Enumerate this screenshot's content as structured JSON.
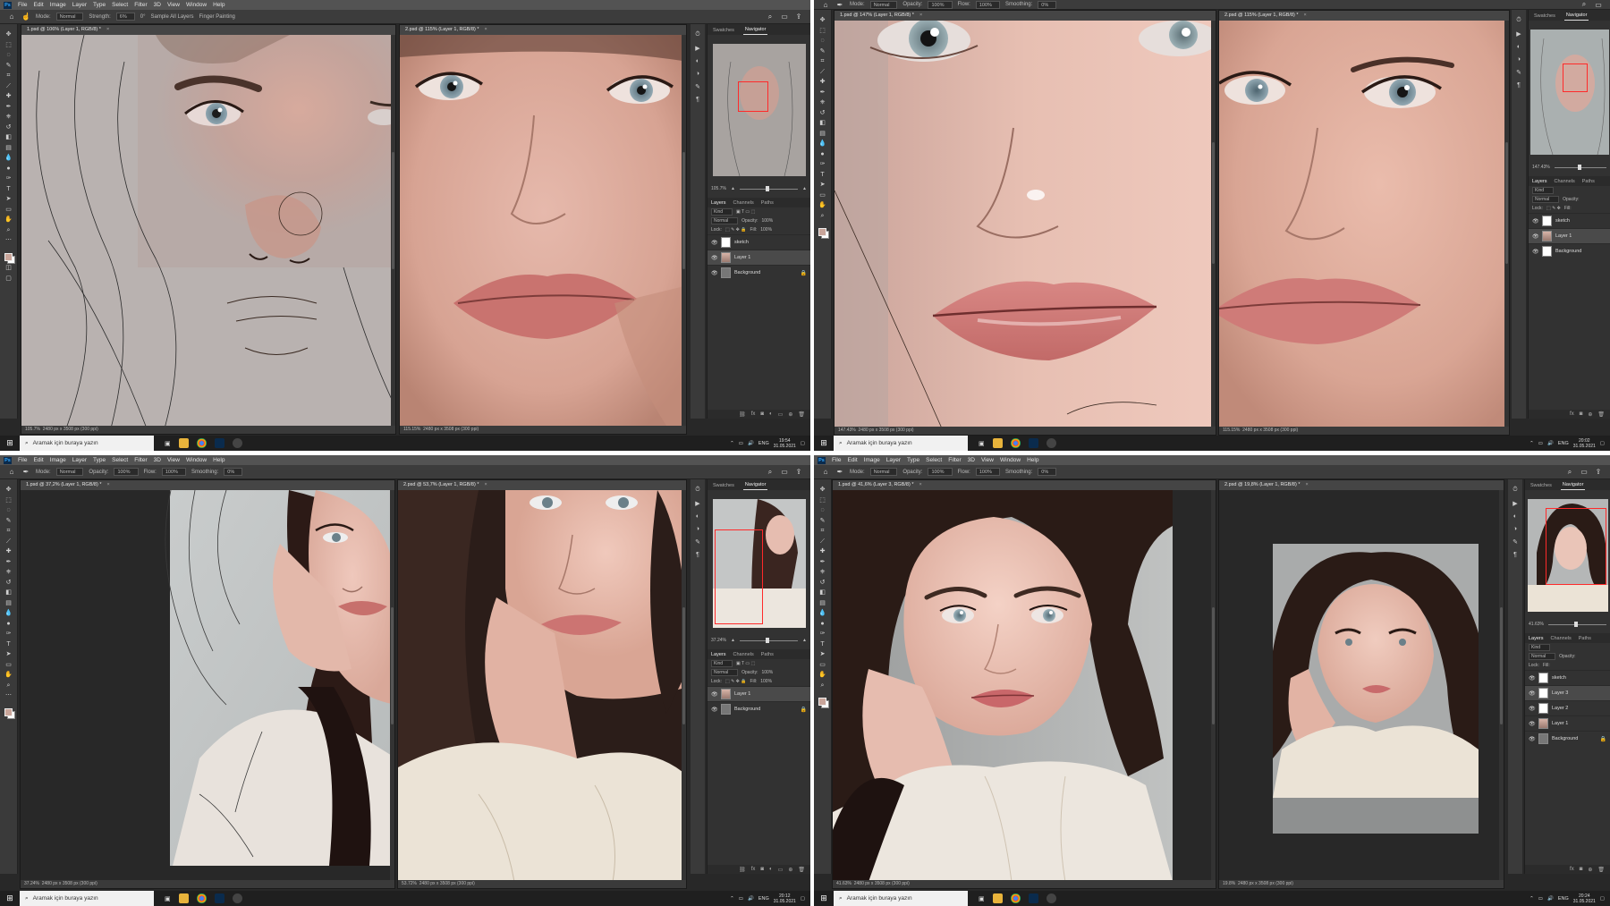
{
  "colors": {
    "accent": "#31a8ff",
    "nav_rect": "#ff2a2a",
    "ui_dark": "#282828",
    "ui_panel": "#323232"
  },
  "menu": [
    "File",
    "Edit",
    "Image",
    "Layer",
    "Type",
    "Select",
    "Filter",
    "3D",
    "View",
    "Window",
    "Help"
  ],
  "panel_tabs": {
    "swatches": "Swatches",
    "navigator": "Navigator",
    "layers": "Layers",
    "channels": "Channels",
    "paths": "Paths"
  },
  "layer_controls": {
    "kind": "Kind",
    "blend": "Normal",
    "opacity_label": "Opacity:",
    "opacity": "100%",
    "lock": "Lock:",
    "fill_label": "Fill:",
    "fill": "100%"
  },
  "taskbar": {
    "search": "Aramak için buraya yazın",
    "lang": "ENG"
  },
  "q1": {
    "options": {
      "mode_label": "Mode:",
      "mode": "Normal",
      "strength_label": "Strength:",
      "strength": "6%",
      "angle": "0°",
      "sample": "Sample All Layers",
      "finger": "Finger Painting"
    },
    "doc_left": {
      "tab": "1.psd @ 106% (Layer 1, RGB/8) *",
      "status": "105.7%",
      "dims": "2480 px x 3508 px (300 ppi)"
    },
    "doc_right": {
      "tab": "2.psd @ 115% (Layer 1, RGB/8) *",
      "status": "115.15%",
      "dims": "2480 px x 3508 px (300 ppi)"
    },
    "nav_zoom": "105.7%",
    "layers": [
      {
        "name": "sketch",
        "selected": false,
        "thumb": "white"
      },
      {
        "name": "Layer 1",
        "selected": true,
        "thumb": "photo"
      },
      {
        "name": "Background",
        "selected": false,
        "thumb": "grey",
        "locked": true
      }
    ],
    "time": "19:54",
    "date": "31.05.2021"
  },
  "q2": {
    "options": {
      "mode_label": "Mode:",
      "mode": "Normal",
      "opacity_label": "Opacity:",
      "opacity": "100%",
      "flow_label": "Flow:",
      "flow": "100%",
      "smoothing_label": "Smoothing:",
      "smoothing": "0%"
    },
    "doc_left": {
      "tab": "1.psd @ 147% (Layer 1, RGB/8) *",
      "status": "147.43%",
      "dims": "2480 px x 3508 px (300 ppi)"
    },
    "doc_right": {
      "tab": "2.psd @ 115% (Layer 1, RGB/8) *",
      "status": "115.15%",
      "dims": "2480 px x 3508 px (300 ppi)"
    },
    "nav_zoom": "147.43%",
    "layers": [
      {
        "name": "sketch",
        "selected": false,
        "thumb": "white"
      },
      {
        "name": "Layer 1",
        "selected": true,
        "thumb": "photo"
      },
      {
        "name": "Background",
        "selected": false,
        "thumb": "white"
      }
    ],
    "time": "20:02",
    "date": "31.05.2021"
  },
  "q3": {
    "options": {
      "mode_label": "Mode:",
      "mode": "Normal",
      "opacity_label": "Opacity:",
      "opacity": "100%",
      "flow_label": "Flow:",
      "flow": "100%",
      "smoothing_label": "Smoothing:",
      "smoothing": "0%"
    },
    "doc_left": {
      "tab": "1.psd @ 37,2% (Layer 1, RGB/8) *",
      "status": "37.24%",
      "dims": "2480 px x 3508 px (300 ppi)"
    },
    "doc_right": {
      "tab": "2.psd @ 53,7% (Layer 1, RGB/8) *",
      "status": "53.72%",
      "dims": "2480 px x 3508 px (300 ppi)"
    },
    "nav_zoom": "37.24%",
    "layers": [
      {
        "name": "Layer 1",
        "selected": true,
        "thumb": "photo"
      },
      {
        "name": "Background",
        "selected": false,
        "thumb": "grey",
        "locked": true
      }
    ],
    "time": "20:12",
    "date": "31.05.2021"
  },
  "q4": {
    "options": {
      "mode_label": "Mode:",
      "mode": "Normal",
      "opacity_label": "Opacity:",
      "opacity": "100%",
      "flow_label": "Flow:",
      "flow": "100%",
      "smoothing_label": "Smoothing:",
      "smoothing": "0%"
    },
    "doc_left": {
      "tab": "1.psd @ 41,6% (Layer 3, RGB/8) *",
      "status": "41.63%",
      "dims": "2480 px x 3508 px (300 ppi)"
    },
    "doc_right": {
      "tab": "2.psd @ 19,8% (Layer 1, RGB/8) *",
      "status": "19.8%",
      "dims": "2480 px x 3508 px (300 ppi)"
    },
    "nav_zoom": "41.63%",
    "layers": [
      {
        "name": "sketch",
        "selected": false,
        "thumb": "white"
      },
      {
        "name": "Layer 3",
        "selected": true,
        "thumb": "white"
      },
      {
        "name": "Layer 2",
        "selected": false,
        "thumb": "white"
      },
      {
        "name": "Layer 1",
        "selected": false,
        "thumb": "photo"
      },
      {
        "name": "Background",
        "selected": false,
        "thumb": "grey",
        "locked": true
      }
    ],
    "time": "20:24",
    "date": "31.05.2021"
  }
}
